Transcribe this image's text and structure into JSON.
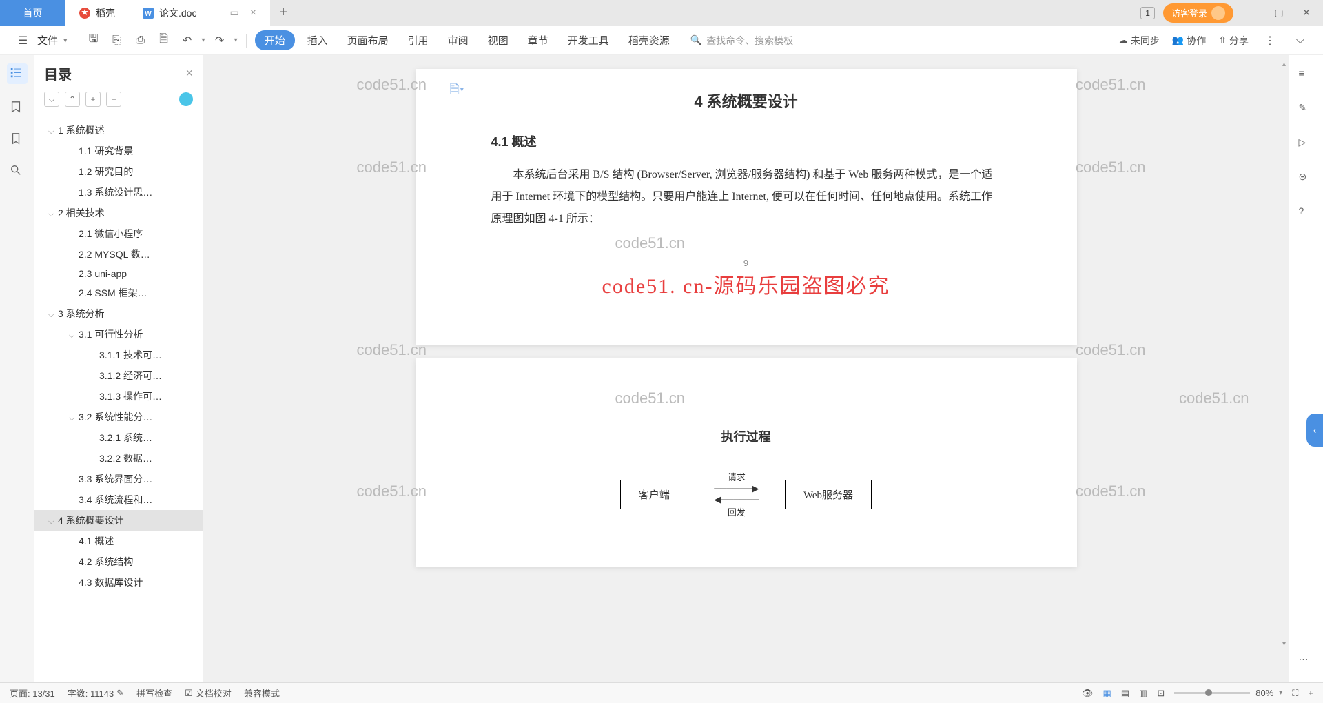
{
  "tabs": {
    "home": "首页",
    "daoke": "稻壳",
    "doc": "论文.doc"
  },
  "login_button": "访客登录",
  "window_badge": "1",
  "toolbar": {
    "file": "文件",
    "menu": [
      "开始",
      "插入",
      "页面布局",
      "引用",
      "审阅",
      "视图",
      "章节",
      "开发工具",
      "稻壳资源"
    ],
    "search_placeholder": "查找命令、搜索模板",
    "unsync": "未同步",
    "collab": "协作",
    "share": "分享"
  },
  "outline": {
    "title": "目录",
    "items": [
      {
        "level": 1,
        "text": "1 系统概述",
        "expand": true
      },
      {
        "level": 2,
        "text": "1.1 研究背景"
      },
      {
        "level": 2,
        "text": "1.2 研究目的"
      },
      {
        "level": 2,
        "text": "1.3 系统设计思…"
      },
      {
        "level": 1,
        "text": "2 相关技术",
        "expand": true
      },
      {
        "level": 2,
        "text": "2.1 微信小程序"
      },
      {
        "level": 2,
        "text": "2.2 MYSQL 数…"
      },
      {
        "level": 2,
        "text": "2.3 uni-app"
      },
      {
        "level": 2,
        "text": "2.4 SSM 框架…"
      },
      {
        "level": 1,
        "text": "3 系统分析",
        "expand": true
      },
      {
        "level": 2,
        "text": "3.1 可行性分析",
        "expand": true
      },
      {
        "level": 3,
        "text": "3.1.1 技术可…"
      },
      {
        "level": 3,
        "text": "3.1.2 经济可…"
      },
      {
        "level": 3,
        "text": "3.1.3 操作可…"
      },
      {
        "level": 2,
        "text": "3.2 系统性能分…",
        "expand": true
      },
      {
        "level": 3,
        "text": "3.2.1  系统…"
      },
      {
        "level": 3,
        "text": "3.2.2  数据…"
      },
      {
        "level": 2,
        "text": "3.3 系统界面分…"
      },
      {
        "level": 2,
        "text": "3.4 系统流程和…"
      },
      {
        "level": 1,
        "text": "4 系统概要设计",
        "expand": true,
        "selected": true
      },
      {
        "level": 2,
        "text": "4.1 概述"
      },
      {
        "level": 2,
        "text": "4.2 系统结构"
      },
      {
        "level": 2,
        "text": "4.3 数据库设计"
      }
    ]
  },
  "document": {
    "heading1": "4 系统概要设计",
    "heading2": "4.1 概述",
    "paragraph": "本系统后台采用 B/S 结构 (Browser/Server, 浏览器/服务器结构) 和基于 Web 服务两种模式，是一个适用于 Internet 环境下的模型结构。只要用户能连上 Internet, 便可以在任何时间、任何地点使用。系统工作原理图如图 4-1 所示：",
    "page_number": "9",
    "watermark_overlay": "code51. cn-源码乐园盗图必究",
    "watermark_small": "code51.cn",
    "section2_title": "执行过程",
    "diagram": {
      "box_left": "客户端",
      "arrow_top": "请求",
      "arrow_bottom": "回发",
      "box_right": "Web服务器"
    }
  },
  "status": {
    "page": "页面: 13/31",
    "words": "字数: 11143",
    "spell": "拼写检查",
    "proofread": "文档校对",
    "compat": "兼容模式",
    "zoom": "80%"
  }
}
